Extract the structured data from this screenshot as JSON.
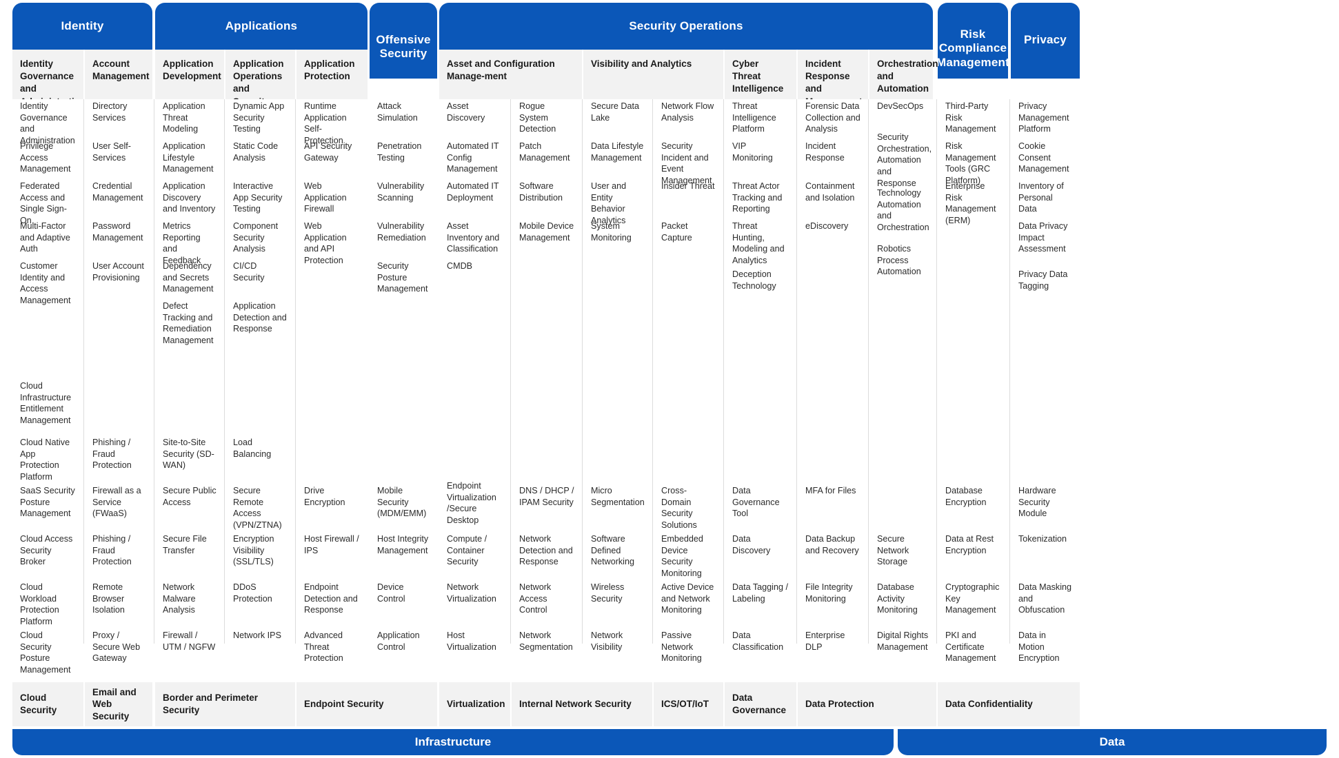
{
  "meta": {
    "accent_blue": "#0b57b8",
    "panel_gray": "#f2f2f2",
    "text_dark": "#2b2b2b"
  },
  "top_banners": [
    {
      "label": "Identity"
    },
    {
      "label": "Applications"
    },
    {
      "label": "Offensive Security"
    },
    {
      "label": "Security Operations"
    },
    {
      "label": "Risk Compliance Management"
    },
    {
      "label": "Privacy"
    }
  ],
  "columns": [
    {
      "header": "Identity Governance and Administration",
      "upper": [
        "Identity Governance and Administration",
        "Privilege Access Management",
        "Federated Access and Single Sign-On",
        "Multi-Factor and Adaptive Auth",
        "Customer Identity and Access Management"
      ],
      "lower": [
        "Cloud Infrastructure Entitlement Management",
        "Cloud Native App Protection Platform",
        "SaaS Security Posture Management",
        "Cloud Access Security Broker",
        "Cloud Workload Protection Platform",
        "Cloud Security Posture Management"
      ],
      "footer": "Cloud Security"
    },
    {
      "header": "Account Management",
      "upper": [
        "Directory Services",
        "User Self-Services",
        "Credential Management",
        "Password Management",
        "User Account Provisioning"
      ],
      "lower": [
        "Phishing / Fraud Protection",
        "Firewall as a Service (FWaaS)",
        "Phishing / Fraud Protection",
        "Remote Browser Isolation",
        "Proxy / Secure Web Gateway"
      ],
      "footer": "Email and Web Security"
    },
    {
      "header": "Application Development",
      "upper": [
        "Application Threat Modeling",
        "Application Lifestyle Management",
        "Application Discovery and Inventory",
        "Metrics Reporting and Feedback",
        "Dependency and Secrets Management",
        "Defect Tracking and Remediation Management"
      ],
      "lower": [
        "Site-to-Site Security (SD-WAN)",
        "Secure Public Access",
        "Secure File Transfer",
        "Network Malware Analysis",
        "Firewall / UTM / NGFW"
      ],
      "footer": "Border and Perimeter Security"
    },
    {
      "header": "Application Operations and Security",
      "upper": [
        "Dynamic App Security Testing",
        "Static Code Analysis",
        "Interactive App Security Testing",
        "Component Security Analysis",
        "CI/CD Security",
        "Application Detection and Response"
      ],
      "lower": [
        "Load Balancing",
        "Secure Remote Access (VPN/ZTNA)",
        "Encryption Visibility (SSL/TLS)",
        "DDoS Protection",
        "Network IPS"
      ],
      "footer": ""
    },
    {
      "header": "Application Protection",
      "upper": [
        "Runtime Application Self- Protection",
        "API Security Gateway",
        "Web Application Firewall",
        "Web Application and API Protection"
      ],
      "lower": [
        "Drive Encryption",
        "Host Firewall / IPS",
        "Endpoint Detection and Response",
        "Advanced Threat Protection"
      ],
      "footer": "Endpoint Security"
    },
    {
      "header": "",
      "upper": [
        "Attack Simulation",
        "Penetration Testing",
        "Vulnerability Scanning",
        "Vulnerability Remediation",
        "Security Posture Management"
      ],
      "lower": [
        "Mobile Security (MDM/EMM)",
        "Host Integrity Management",
        "Device Control",
        "Application Control"
      ],
      "footer": ""
    },
    {
      "header": "Asset and Configuration Manage-ment",
      "upper": [
        "Asset Discovery",
        "Automated IT Config Management",
        "Automated IT Deployment",
        "Asset Inventory and Classification",
        "CMDB"
      ],
      "lower": [
        "Endpoint Virtualization /Secure Desktop",
        "Compute / Container Security",
        "Network Virtualization",
        "Host Virtualization"
      ],
      "footer": "Virtualization"
    },
    {
      "header": "",
      "upper": [
        "Rogue System Detection",
        "Patch Management",
        "Software Distribution",
        "Mobile Device Management"
      ],
      "lower": [
        "DNS / DHCP / IPAM Security",
        "Network Detection and Response",
        "Network Access Control",
        "Network Segmentation"
      ],
      "footer": "Internal Network Security"
    },
    {
      "header": "Visibility and Analytics",
      "upper": [
        "Secure Data Lake",
        "Data Lifestyle Management",
        "User and Entity Behavior Analytics",
        "System Monitoring"
      ],
      "lower": [
        "Micro Segmentation",
        "Software Defined Networking",
        "Wireless Security",
        "Network Visibility"
      ],
      "footer": ""
    },
    {
      "header": "",
      "upper": [
        "Network Flow Analysis",
        "Security Incident and Event Management",
        "Insider Threat",
        "Packet Capture"
      ],
      "lower": [
        "Cross-Domain Security Solutions",
        "Embedded Device Security Monitoring",
        "Active Device and Network Monitoring",
        "Passive Network Monitoring"
      ],
      "footer": "ICS/OT/IoT"
    },
    {
      "header": "Cyber Threat Intelligence",
      "upper": [
        "Threat Intelligence Platform",
        "VIP Monitoring",
        "Threat Actor Tracking and Reporting",
        "Threat Hunting, Modeling and Analytics",
        "Deception Technology"
      ],
      "lower": [
        "Data Governance Tool",
        "Data Discovery",
        "Data Tagging / Labeling",
        "Data Classification"
      ],
      "footer": "Data Governance"
    },
    {
      "header": "Incident Response and Management",
      "upper": [
        "Forensic Data Collection and Analysis",
        "Incident Response",
        "Containment and Isolation",
        "eDiscovery"
      ],
      "lower": [
        "MFA for Files",
        "Data Backup and Recovery",
        "File Integrity Monitoring",
        "Enterprise DLP"
      ],
      "footer": "Data Protection"
    },
    {
      "header": "Orchestration and Automation",
      "upper": [
        "DevSecOps",
        "Security Orchestration, Automation and Response",
        "Technology Automation and Orchestration",
        "Robotics Process Automation"
      ],
      "lower": [
        "Secure Network Storage",
        "Database Activity Monitoring",
        "Digital Rights Management"
      ],
      "footer": ""
    },
    {
      "header": "",
      "upper": [
        "Third-Party Risk Management",
        "Risk Management Tools (GRC Platform)",
        "Enterprise Risk Management (ERM)"
      ],
      "lower": [
        "Database Encryption",
        "Data at Rest Encryption",
        "Cryptographic Key Management",
        "PKI and Certificate Management"
      ],
      "footer": "Data Confidentiality"
    },
    {
      "header": "",
      "upper": [
        "Privacy Management Platform",
        "Cookie Consent Management",
        "Inventory of Personal Data",
        "Data Privacy Impact Assessment",
        "Privacy Data Tagging"
      ],
      "lower": [
        "Hardware Security Module",
        "Tokenization",
        "Data Masking and Obfuscation",
        "Data in Motion Encryption"
      ],
      "footer": ""
    }
  ],
  "pillars": [
    {
      "label": "Infrastructure"
    },
    {
      "label": "Data"
    }
  ]
}
